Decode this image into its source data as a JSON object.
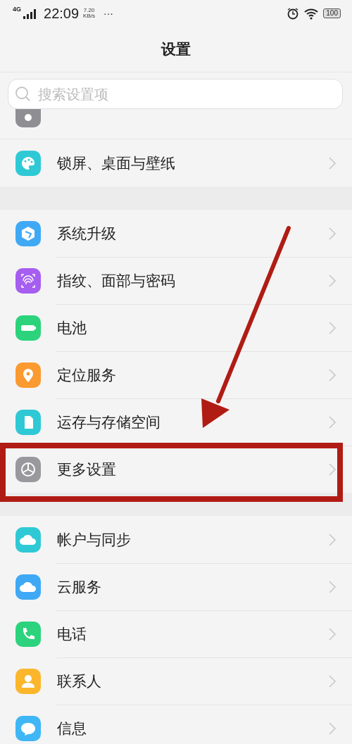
{
  "status_bar": {
    "network": "4G",
    "time": "22:09",
    "speed_value": "7.20",
    "speed_unit": "KB/s",
    "more": "···",
    "battery": "100"
  },
  "title": "设置",
  "search": {
    "placeholder": "搜索设置项"
  },
  "partial_item": {
    "color": "#8e8e93"
  },
  "sections": [
    {
      "items": [
        {
          "label": "锁屏、桌面与壁纸",
          "color": "#2fc9d6",
          "highlighted": false
        }
      ]
    },
    {
      "items": [
        {
          "label": "系统升级",
          "color": "#3fa9f5",
          "highlighted": false
        },
        {
          "label": "指纹、面部与密码",
          "color": "#a55ef0",
          "highlighted": false
        },
        {
          "label": "电池",
          "color": "#2cd37c",
          "highlighted": false
        },
        {
          "label": "定位服务",
          "color": "#fb9a30",
          "highlighted": false
        },
        {
          "label": "运存与存储空间",
          "color": "#2fc9d6",
          "highlighted": false
        },
        {
          "label": "更多设置",
          "color": "#98989d",
          "highlighted": true
        }
      ]
    },
    {
      "items": [
        {
          "label": "帐户与同步",
          "color": "#2fc9d6",
          "highlighted": false
        },
        {
          "label": "云服务",
          "color": "#3fa9f5",
          "highlighted": false
        },
        {
          "label": "电话",
          "color": "#2cd37c",
          "highlighted": false
        },
        {
          "label": "联系人",
          "color": "#fbb62c",
          "highlighted": false
        },
        {
          "label": "信息",
          "color": "#3fb6f5",
          "highlighted": false
        }
      ]
    }
  ]
}
